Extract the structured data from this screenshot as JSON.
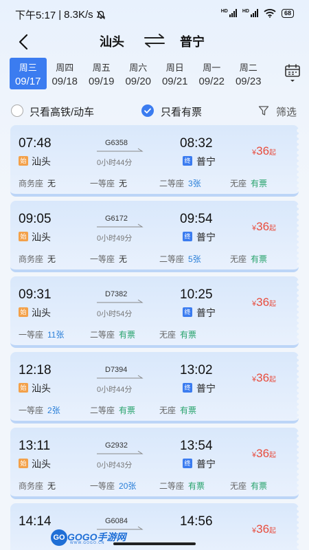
{
  "status": {
    "time": "下午5:17",
    "speed": "8.3K/s",
    "battery": "68",
    "sig1_tag": "HD",
    "sig2_tag": "HD"
  },
  "header": {
    "from": "汕头",
    "to": "普宁"
  },
  "dates": [
    {
      "weekday": "周三",
      "date": "09/17",
      "active": true
    },
    {
      "weekday": "周四",
      "date": "09/18"
    },
    {
      "weekday": "周五",
      "date": "09/19"
    },
    {
      "weekday": "周六",
      "date": "09/20"
    },
    {
      "weekday": "周日",
      "date": "09/21"
    },
    {
      "weekday": "周一",
      "date": "09/22"
    },
    {
      "weekday": "周二",
      "date": "09/23"
    }
  ],
  "filters": {
    "high_speed_only": "只看高铁/动车",
    "has_ticket_only": "只看有票",
    "filter_label": "筛选"
  },
  "trains": [
    {
      "dep_time": "07:48",
      "arr_time": "08:32",
      "train_no": "G6358",
      "duration": "0小时44分",
      "dep_station": "汕头",
      "arr_station": "普宁",
      "start_badge": "始",
      "end_badge": "终",
      "price_currency": "¥",
      "price": "36",
      "price_suffix": "起",
      "seats": [
        {
          "name": "商务座",
          "value": "无",
          "kind": "none"
        },
        {
          "name": "一等座",
          "value": "无",
          "kind": "none"
        },
        {
          "name": "二等座",
          "value": "3张",
          "kind": "count"
        },
        {
          "name": "无座",
          "value": "有票",
          "kind": "avail"
        }
      ]
    },
    {
      "dep_time": "09:05",
      "arr_time": "09:54",
      "train_no": "G6172",
      "duration": "0小时49分",
      "dep_station": "汕头",
      "arr_station": "普宁",
      "start_badge": "始",
      "end_badge": "终",
      "price_currency": "¥",
      "price": "36",
      "price_suffix": "起",
      "seats": [
        {
          "name": "商务座",
          "value": "无",
          "kind": "none"
        },
        {
          "name": "一等座",
          "value": "无",
          "kind": "none"
        },
        {
          "name": "二等座",
          "value": "5张",
          "kind": "count"
        },
        {
          "name": "无座",
          "value": "有票",
          "kind": "avail"
        }
      ]
    },
    {
      "dep_time": "09:31",
      "arr_time": "10:25",
      "train_no": "D7382",
      "duration": "0小时54分",
      "dep_station": "汕头",
      "arr_station": "普宁",
      "start_badge": "始",
      "end_badge": "终",
      "price_currency": "¥",
      "price": "36",
      "price_suffix": "起",
      "seats": [
        {
          "name": "一等座",
          "value": "11张",
          "kind": "count"
        },
        {
          "name": "二等座",
          "value": "有票",
          "kind": "avail"
        },
        {
          "name": "无座",
          "value": "有票",
          "kind": "avail"
        }
      ]
    },
    {
      "dep_time": "12:18",
      "arr_time": "13:02",
      "train_no": "D7394",
      "duration": "0小时44分",
      "dep_station": "汕头",
      "arr_station": "普宁",
      "start_badge": "始",
      "end_badge": "终",
      "price_currency": "¥",
      "price": "36",
      "price_suffix": "起",
      "seats": [
        {
          "name": "一等座",
          "value": "2张",
          "kind": "count"
        },
        {
          "name": "二等座",
          "value": "有票",
          "kind": "avail"
        },
        {
          "name": "无座",
          "value": "有票",
          "kind": "avail"
        }
      ]
    },
    {
      "dep_time": "13:11",
      "arr_time": "13:54",
      "train_no": "G2932",
      "duration": "0小时43分",
      "dep_station": "汕头",
      "arr_station": "普宁",
      "start_badge": "始",
      "end_badge": "终",
      "price_currency": "¥",
      "price": "36",
      "price_suffix": "起",
      "seats": [
        {
          "name": "商务座",
          "value": "无",
          "kind": "none"
        },
        {
          "name": "一等座",
          "value": "20张",
          "kind": "count"
        },
        {
          "name": "二等座",
          "value": "有票",
          "kind": "avail"
        },
        {
          "name": "无座",
          "value": "有票",
          "kind": "avail"
        }
      ]
    },
    {
      "dep_time": "14:14",
      "arr_time": "14:56",
      "train_no": "G6084",
      "duration": "",
      "dep_station": "",
      "arr_station": "",
      "start_badge": "",
      "end_badge": "",
      "price_currency": "¥",
      "price": "36",
      "price_suffix": "起",
      "seats": []
    }
  ],
  "watermark": {
    "logo": "GO",
    "text": "GOGO手游网",
    "sub": "WWW.GOGO.CN"
  },
  "colors": {
    "accent": "#3b7cf0",
    "price": "#e84c3d",
    "available": "#27a36b",
    "count": "#2a7fd8",
    "start_badge": "#f3a14a"
  }
}
